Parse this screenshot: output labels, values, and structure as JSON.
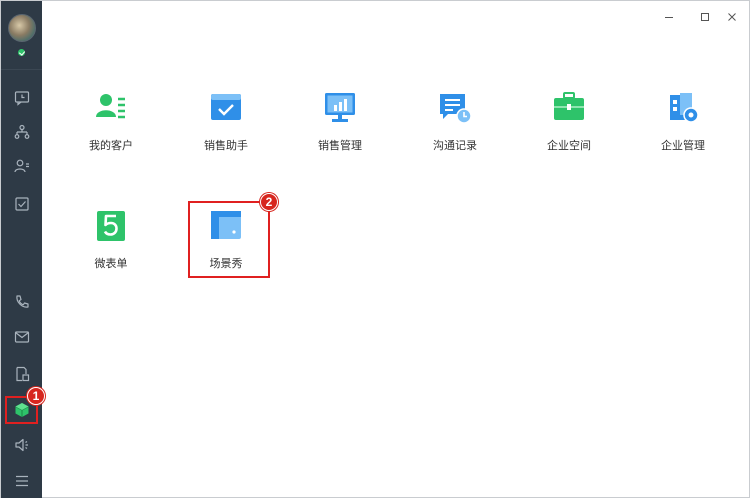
{
  "window": {
    "controls": {
      "minimize": "minimize-icon",
      "maximize": "maximize-icon",
      "close": "close-icon"
    }
  },
  "sidebar": {
    "status_color": "#2ec36a",
    "items": [
      {
        "icon": "clock-chat-icon"
      },
      {
        "icon": "org-chart-icon"
      },
      {
        "icon": "contacts-icon"
      },
      {
        "icon": "checkbox-icon"
      },
      {
        "icon": "phone-icon"
      },
      {
        "icon": "mail-icon"
      },
      {
        "icon": "doc-approval-icon"
      },
      {
        "icon": "apps-cube-icon",
        "active": true
      },
      {
        "icon": "speaker-icon"
      },
      {
        "icon": "menu-icon"
      }
    ]
  },
  "apps": [
    {
      "label": "我的客户",
      "icon": "customer-icon",
      "color": "#2ec36a"
    },
    {
      "label": "销售助手",
      "icon": "sales-assistant-icon",
      "color": "#2f8fe8"
    },
    {
      "label": "销售管理",
      "icon": "sales-management-icon",
      "color": "#2f8fe8"
    },
    {
      "label": "沟通记录",
      "icon": "communication-log-icon",
      "color": "#2f8fe8"
    },
    {
      "label": "企业空间",
      "icon": "enterprise-space-icon",
      "color": "#2ec36a"
    },
    {
      "label": "企业管理",
      "icon": "enterprise-management-icon",
      "color": "#2f8fe8"
    },
    {
      "label": "微表单",
      "icon": "micro-form-icon",
      "color": "#2ec36a"
    },
    {
      "label": "场景秀",
      "icon": "scene-show-icon",
      "color": "#2f8fe8"
    }
  ],
  "annotations": {
    "step1": "1",
    "step2": "2",
    "highlight_color": "#e02020"
  }
}
